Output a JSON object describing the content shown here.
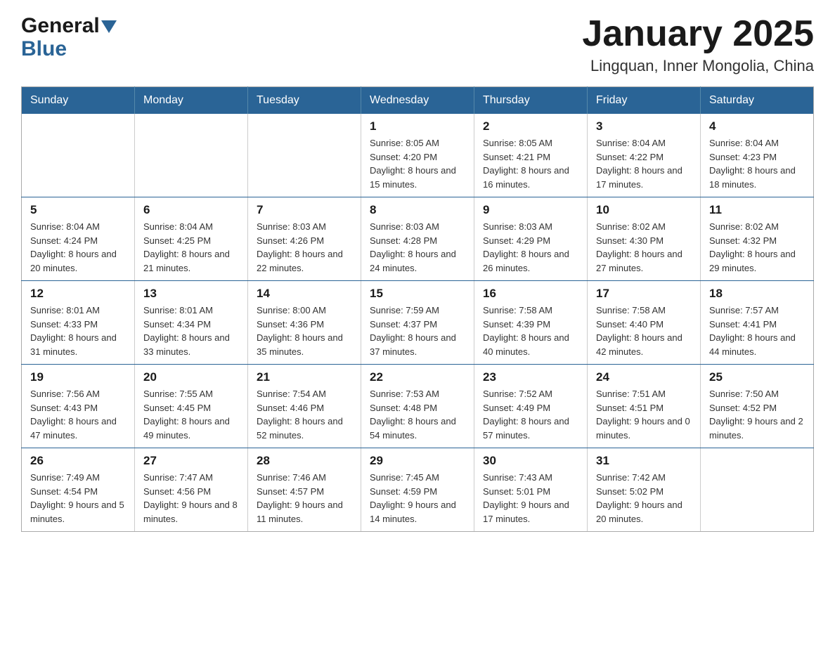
{
  "header": {
    "logo_general": "General",
    "logo_blue": "Blue",
    "title": "January 2025",
    "subtitle": "Lingquan, Inner Mongolia, China"
  },
  "weekdays": [
    "Sunday",
    "Monday",
    "Tuesday",
    "Wednesday",
    "Thursday",
    "Friday",
    "Saturday"
  ],
  "weeks": [
    [
      {
        "day": "",
        "sunrise": "",
        "sunset": "",
        "daylight": ""
      },
      {
        "day": "",
        "sunrise": "",
        "sunset": "",
        "daylight": ""
      },
      {
        "day": "",
        "sunrise": "",
        "sunset": "",
        "daylight": ""
      },
      {
        "day": "1",
        "sunrise": "Sunrise: 8:05 AM",
        "sunset": "Sunset: 4:20 PM",
        "daylight": "Daylight: 8 hours and 15 minutes."
      },
      {
        "day": "2",
        "sunrise": "Sunrise: 8:05 AM",
        "sunset": "Sunset: 4:21 PM",
        "daylight": "Daylight: 8 hours and 16 minutes."
      },
      {
        "day": "3",
        "sunrise": "Sunrise: 8:04 AM",
        "sunset": "Sunset: 4:22 PM",
        "daylight": "Daylight: 8 hours and 17 minutes."
      },
      {
        "day": "4",
        "sunrise": "Sunrise: 8:04 AM",
        "sunset": "Sunset: 4:23 PM",
        "daylight": "Daylight: 8 hours and 18 minutes."
      }
    ],
    [
      {
        "day": "5",
        "sunrise": "Sunrise: 8:04 AM",
        "sunset": "Sunset: 4:24 PM",
        "daylight": "Daylight: 8 hours and 20 minutes."
      },
      {
        "day": "6",
        "sunrise": "Sunrise: 8:04 AM",
        "sunset": "Sunset: 4:25 PM",
        "daylight": "Daylight: 8 hours and 21 minutes."
      },
      {
        "day": "7",
        "sunrise": "Sunrise: 8:03 AM",
        "sunset": "Sunset: 4:26 PM",
        "daylight": "Daylight: 8 hours and 22 minutes."
      },
      {
        "day": "8",
        "sunrise": "Sunrise: 8:03 AM",
        "sunset": "Sunset: 4:28 PM",
        "daylight": "Daylight: 8 hours and 24 minutes."
      },
      {
        "day": "9",
        "sunrise": "Sunrise: 8:03 AM",
        "sunset": "Sunset: 4:29 PM",
        "daylight": "Daylight: 8 hours and 26 minutes."
      },
      {
        "day": "10",
        "sunrise": "Sunrise: 8:02 AM",
        "sunset": "Sunset: 4:30 PM",
        "daylight": "Daylight: 8 hours and 27 minutes."
      },
      {
        "day": "11",
        "sunrise": "Sunrise: 8:02 AM",
        "sunset": "Sunset: 4:32 PM",
        "daylight": "Daylight: 8 hours and 29 minutes."
      }
    ],
    [
      {
        "day": "12",
        "sunrise": "Sunrise: 8:01 AM",
        "sunset": "Sunset: 4:33 PM",
        "daylight": "Daylight: 8 hours and 31 minutes."
      },
      {
        "day": "13",
        "sunrise": "Sunrise: 8:01 AM",
        "sunset": "Sunset: 4:34 PM",
        "daylight": "Daylight: 8 hours and 33 minutes."
      },
      {
        "day": "14",
        "sunrise": "Sunrise: 8:00 AM",
        "sunset": "Sunset: 4:36 PM",
        "daylight": "Daylight: 8 hours and 35 minutes."
      },
      {
        "day": "15",
        "sunrise": "Sunrise: 7:59 AM",
        "sunset": "Sunset: 4:37 PM",
        "daylight": "Daylight: 8 hours and 37 minutes."
      },
      {
        "day": "16",
        "sunrise": "Sunrise: 7:58 AM",
        "sunset": "Sunset: 4:39 PM",
        "daylight": "Daylight: 8 hours and 40 minutes."
      },
      {
        "day": "17",
        "sunrise": "Sunrise: 7:58 AM",
        "sunset": "Sunset: 4:40 PM",
        "daylight": "Daylight: 8 hours and 42 minutes."
      },
      {
        "day": "18",
        "sunrise": "Sunrise: 7:57 AM",
        "sunset": "Sunset: 4:41 PM",
        "daylight": "Daylight: 8 hours and 44 minutes."
      }
    ],
    [
      {
        "day": "19",
        "sunrise": "Sunrise: 7:56 AM",
        "sunset": "Sunset: 4:43 PM",
        "daylight": "Daylight: 8 hours and 47 minutes."
      },
      {
        "day": "20",
        "sunrise": "Sunrise: 7:55 AM",
        "sunset": "Sunset: 4:45 PM",
        "daylight": "Daylight: 8 hours and 49 minutes."
      },
      {
        "day": "21",
        "sunrise": "Sunrise: 7:54 AM",
        "sunset": "Sunset: 4:46 PM",
        "daylight": "Daylight: 8 hours and 52 minutes."
      },
      {
        "day": "22",
        "sunrise": "Sunrise: 7:53 AM",
        "sunset": "Sunset: 4:48 PM",
        "daylight": "Daylight: 8 hours and 54 minutes."
      },
      {
        "day": "23",
        "sunrise": "Sunrise: 7:52 AM",
        "sunset": "Sunset: 4:49 PM",
        "daylight": "Daylight: 8 hours and 57 minutes."
      },
      {
        "day": "24",
        "sunrise": "Sunrise: 7:51 AM",
        "sunset": "Sunset: 4:51 PM",
        "daylight": "Daylight: 9 hours and 0 minutes."
      },
      {
        "day": "25",
        "sunrise": "Sunrise: 7:50 AM",
        "sunset": "Sunset: 4:52 PM",
        "daylight": "Daylight: 9 hours and 2 minutes."
      }
    ],
    [
      {
        "day": "26",
        "sunrise": "Sunrise: 7:49 AM",
        "sunset": "Sunset: 4:54 PM",
        "daylight": "Daylight: 9 hours and 5 minutes."
      },
      {
        "day": "27",
        "sunrise": "Sunrise: 7:47 AM",
        "sunset": "Sunset: 4:56 PM",
        "daylight": "Daylight: 9 hours and 8 minutes."
      },
      {
        "day": "28",
        "sunrise": "Sunrise: 7:46 AM",
        "sunset": "Sunset: 4:57 PM",
        "daylight": "Daylight: 9 hours and 11 minutes."
      },
      {
        "day": "29",
        "sunrise": "Sunrise: 7:45 AM",
        "sunset": "Sunset: 4:59 PM",
        "daylight": "Daylight: 9 hours and 14 minutes."
      },
      {
        "day": "30",
        "sunrise": "Sunrise: 7:43 AM",
        "sunset": "Sunset: 5:01 PM",
        "daylight": "Daylight: 9 hours and 17 minutes."
      },
      {
        "day": "31",
        "sunrise": "Sunrise: 7:42 AM",
        "sunset": "Sunset: 5:02 PM",
        "daylight": "Daylight: 9 hours and 20 minutes."
      },
      {
        "day": "",
        "sunrise": "",
        "sunset": "",
        "daylight": ""
      }
    ]
  ],
  "colors": {
    "header_bg": "#2a6496",
    "header_text": "#ffffff",
    "border": "#2a6496",
    "title_color": "#1a1a1a",
    "logo_blue": "#2a6496"
  }
}
